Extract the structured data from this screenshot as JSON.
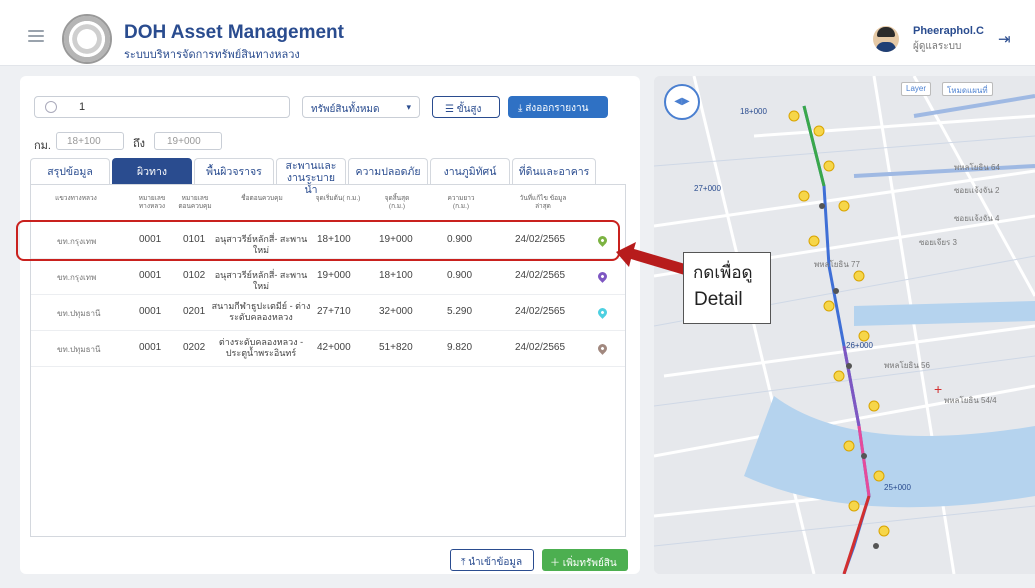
{
  "header": {
    "title": "DOH Asset Management",
    "subtitle": "ระบบบริหารจัดการทรัพย์สินทางหลวง",
    "user_name": "Pheeraphol.C",
    "user_role": "ผู้ดูแลระบบ"
  },
  "search": {
    "value": "1"
  },
  "asset_filter": "ทรัพย์สินทั้งหมด",
  "advanced_label": "ขั้นสูง",
  "export_label": "ส่งออกรายงาน",
  "km": {
    "label": "กม.",
    "from": "18+100",
    "to_label": "ถึง",
    "to": "19+000"
  },
  "tabs": [
    {
      "label": "สรุปข้อมูล"
    },
    {
      "label": "ผิวทาง"
    },
    {
      "label": "พื้นผิวจราจร"
    },
    {
      "label": "สะพานและ งานระบายน้ำ"
    },
    {
      "label": "ความปลอดภัย"
    },
    {
      "label": "งานภูมิทัศน์"
    },
    {
      "label": "ที่ดินและอาคาร"
    }
  ],
  "active_tab": "ผิวทาง",
  "table": {
    "headers": [
      "แขวงทางหลวง",
      "หมายเลข ทางหลวง",
      "หมายเลข ตอนควบคุม",
      "ชื่อตอนควบคุม",
      "จุดเริ่มต้น( ก.ม.)",
      "จุดสิ้นสุด (ก.ม.)",
      "ความยาว (ก.ม.)",
      "วันที่แก้ไข ข้อมูลล่าสุด"
    ],
    "rows": [
      {
        "district": "ขท.กรุงเทพ",
        "highway": "0001",
        "section": "0101",
        "name": "อนุสาวรีย์หลักสี่- สะพานใหม่",
        "start": "18+100",
        "end": "19+000",
        "length": "0.900",
        "date": "24/02/2565",
        "pin_color": "#7cb342"
      },
      {
        "district": "ขท.กรุงเทพ",
        "highway": "0001",
        "section": "0102",
        "name": "อนุสาวรีย์หลักสี่- สะพานใหม่",
        "start": "19+000",
        "end": "18+100",
        "length": "0.900",
        "date": "24/02/2565",
        "pin_color": "#7e57c2"
      },
      {
        "district": "ขท.ปทุมธานี",
        "highway": "0001",
        "section": "0201",
        "name": "สนามกีฬาธูปะเตมีย์ - ต่างระดับคลองหลวง",
        "start": "27+710",
        "end": "32+000",
        "length": "5.290",
        "date": "24/02/2565",
        "pin_color": "#4dd0e1"
      },
      {
        "district": "ขท.ปทุมธานี",
        "highway": "0001",
        "section": "0202",
        "name": "ต่างระดับคลองหลวง - ประตูน้ำพระอินทร์",
        "start": "42+000",
        "end": "51+820",
        "length": "9.820",
        "date": "24/02/2565",
        "pin_color": "#a1887f"
      }
    ]
  },
  "import_label": "นำเข้าข้อมูล",
  "add_label": "เพิ่มทรัพย์สิน",
  "callout": {
    "line1": "กดเพื่อดู",
    "line2": "Detail"
  },
  "map": {
    "layer_label": "Layer",
    "basemap_label": "โหมดแผนที่",
    "km_markers": [
      "18+000",
      "27+000",
      "26+000",
      "25+000"
    ],
    "road_labels": [
      "พหลโยธิน 64",
      "ซอยแจ้งจัน 2",
      "ซอยแจ้งจัน 4",
      "พหลโยธิน 77",
      "พหลโยธิน 56",
      "พหลโยธิน 54/4",
      "ซอยเจียร 3"
    ]
  }
}
